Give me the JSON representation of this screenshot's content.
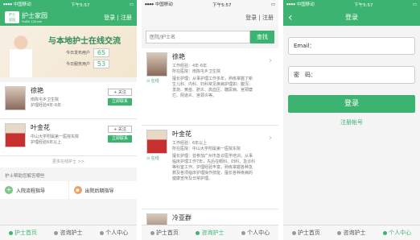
{
  "status": {
    "carrier": "⦁⦁⦁⦁ 中国移动",
    "time": "下午5:57",
    "battery": "▭"
  },
  "p1": {
    "logo_top": "护士",
    "logo_bottom": "家园",
    "app_title": "护士家园",
    "app_sub": "HuShi 120.net",
    "login": "登录",
    "sep": "|",
    "register": "注册",
    "banner": "与本地护士在线交流",
    "stat1_label": "今日发布用户",
    "stat1_value": "65",
    "stat2_label": "今日服务用户",
    "stat2_value": "53",
    "nurses": [
      {
        "name": "徐艳",
        "line1": "南陈屯乡卫生院",
        "line2": "护理经验4年-6年",
        "follow": "+ 关注",
        "ask": "立即联系"
      },
      {
        "name": "叶金花",
        "line1": "中山大学附属第一医院东院",
        "line2": "护理经验6年以上",
        "follow": "+ 关注",
        "ask": "立即联系"
      }
    ],
    "more": "更多在线护士 >>",
    "section": "护士帮助您解答哪些",
    "help1": "入院流程指导",
    "help2": "出院后期指导"
  },
  "p2": {
    "login": "登录",
    "sep": "|",
    "register": "注册",
    "search_placeholder": "医院/护士名",
    "search_btn": "查找",
    "nurses": [
      {
        "name": "徐艳",
        "exp": "工作经验：4年-6年",
        "hosp": "所在医院：南陈屯乡卫生院",
        "desc": "擅长护理：从事护理工作多年，熟练掌握了新生儿科、内科、妇科常见疾病护理如：腹泻、发烧、黄疸、脐炎、高血压、糖尿病、宫颈糜烂、阴道炎、宫颈炎等。",
        "online": "在线"
      },
      {
        "name": "叶金花",
        "exp": "工作经验：6年以上",
        "hosp": "所在医院：中山大学附属第一医院东院",
        "desc": "擅长护理：曾参加广州市急诊医学培训，从事临床护理工作7年，先后在眼科、妇科、急诊科等科室工作。护理经验丰富，熟练掌握各种急救及各项临床护理操作技能，擅长各种疾病的健康宣传及日常护理。",
        "online": "在线"
      },
      {
        "name": "冷亚群",
        "exp": "",
        "hosp": "",
        "desc": "",
        "online": ""
      }
    ]
  },
  "p3": {
    "back": "‹",
    "title": "登录",
    "email_label": "Email：",
    "pwd_label": "密　码：",
    "login_btn": "登录",
    "register_link": "注册帐号"
  },
  "tabs": {
    "home": "护士首页",
    "consult": "咨询护士",
    "me": "个人中心"
  }
}
